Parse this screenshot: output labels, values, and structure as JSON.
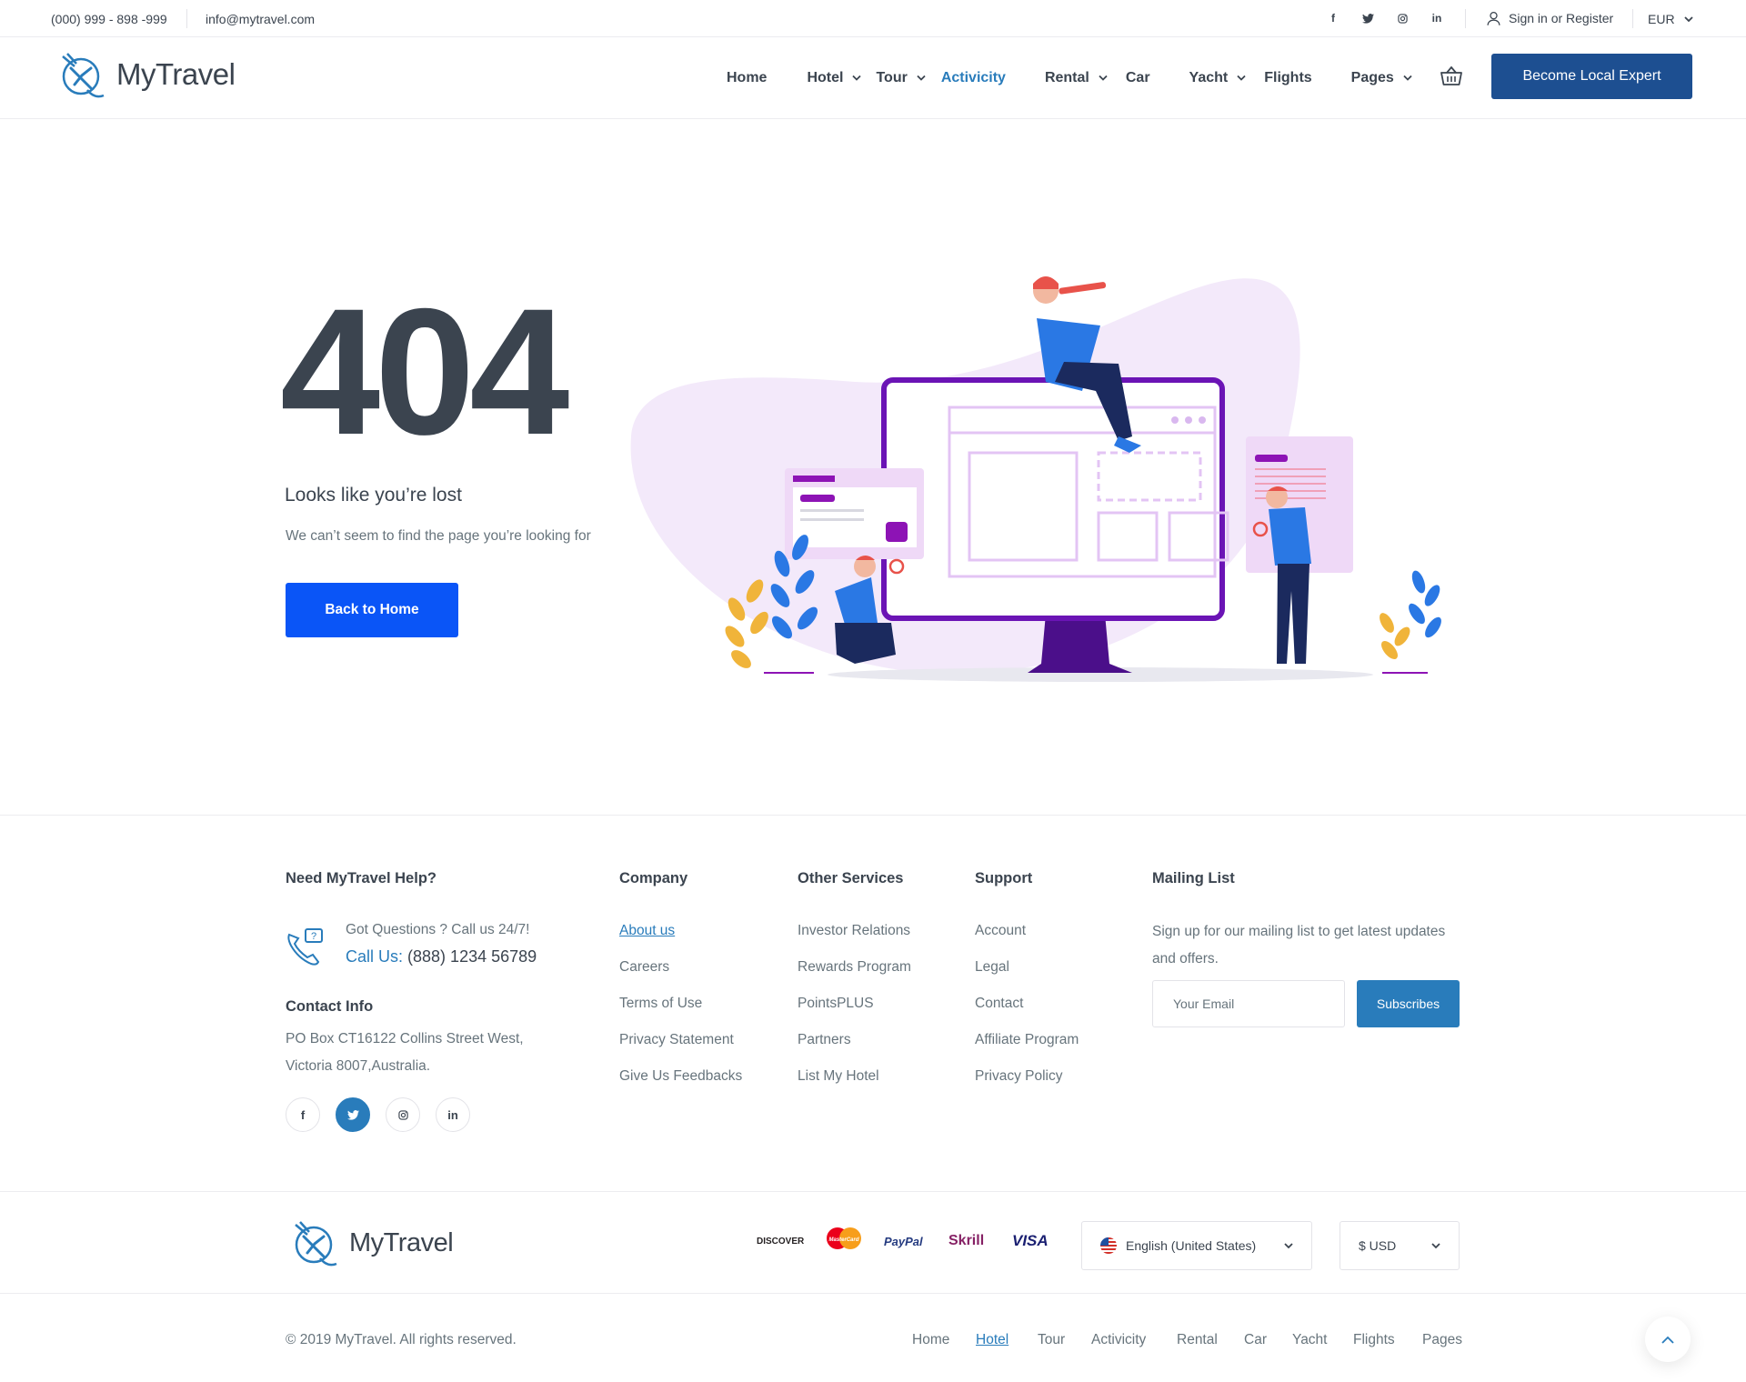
{
  "topbar": {
    "phone": "(000) 999 - 898 -999",
    "email": "info@mytravel.com",
    "socials": [
      "f",
      "t",
      "ig",
      "in"
    ],
    "signin": "Sign in or Register",
    "currency": "EUR"
  },
  "header": {
    "brand": "MyTravel",
    "nav": [
      "Home",
      "Hotel",
      "Tour",
      "Activicity",
      "Rental",
      "Car",
      "Yacht",
      "Flights",
      "Pages"
    ],
    "active_nav": "Activicity",
    "cta": "Become Local Expert"
  },
  "hero": {
    "code": "404",
    "title": "Looks like you’re lost",
    "subtitle": "We can’t seem to find the page you’re looking for",
    "button": "Back to Home"
  },
  "footer": {
    "help": {
      "title": "Need MyTravel Help?",
      "question": "Got Questions ? Call us 24/7!",
      "call_label": "Call Us:",
      "call_number": "(888) 1234 56789"
    },
    "contact": {
      "title": "Contact Info",
      "address": "PO Box CT16122 Collins Street West, Victoria 8007,Australia."
    },
    "company": {
      "title": "Company",
      "links": [
        "About us",
        "Careers",
        "Terms of Use",
        "Privacy Statement",
        "Give Us Feedbacks"
      ]
    },
    "services": {
      "title": "Other Services",
      "links": [
        "Investor Relations",
        "Rewards Program",
        "PointsPLUS",
        "Partners",
        "List My Hotel"
      ]
    },
    "support": {
      "title": "Support",
      "links": [
        "Account",
        "Legal",
        "Contact",
        "Affiliate Program",
        "Privacy Policy"
      ]
    },
    "mailing": {
      "title": "Mailing List",
      "text": "Sign up for our mailing list to get latest updates and offers.",
      "placeholder": "Your Email",
      "button": "Subscribes"
    }
  },
  "footer_bar": {
    "brand": "MyTravel",
    "payments": [
      "DISCOVER",
      "MasterCard",
      "PayPal",
      "Skrill",
      "VISA"
    ],
    "language": "English (United States)",
    "currency": "$ USD"
  },
  "bottom": {
    "copyright": "© 2019 MyTravel. All rights reserved.",
    "nav": [
      "Home",
      "Hotel",
      "Tour",
      "Activicity",
      "Rental",
      "Car",
      "Yacht",
      "Flights",
      "Pages"
    ],
    "active_nav": "Hotel"
  },
  "colors": {
    "primary": "#297cbb",
    "cta_dark": "#1d4f91",
    "back_button": "#0a55f7",
    "text": "#3b444f",
    "muted": "#67747c"
  }
}
